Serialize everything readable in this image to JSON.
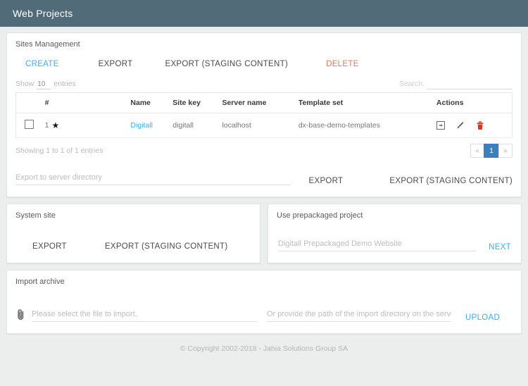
{
  "appbar": {
    "title": "Web Projects"
  },
  "sites_card": {
    "title": "Sites Management",
    "actions": {
      "create": "CREATE",
      "export": "EXPORT",
      "export_staging": "EXPORT (STAGING CONTENT)",
      "delete": "DELETE"
    },
    "datatable": {
      "length_prefix": "Show",
      "length_value": "10",
      "length_suffix": "entries",
      "search_label": "Search:",
      "search_value": "",
      "search_placeholder": "",
      "columns": [
        "",
        "#",
        "Name",
        "Site key",
        "Server name",
        "Template set",
        "Actions"
      ],
      "rows": [
        {
          "checked": false,
          "index": "1",
          "starred": "★",
          "name": "Digitall",
          "site_key": "digitall",
          "server_name": "localhost",
          "template_set": "dx-base-demo-templates",
          "actions": [
            "export-site-icon",
            "edit-icon",
            "delete-icon"
          ]
        }
      ],
      "info": "Showing 1 to 1 of 1 entries",
      "pagination": {
        "prev": "«",
        "pages": [
          "1"
        ],
        "next": "»",
        "active": "1"
      }
    },
    "export_dir": {
      "placeholder": "Export to server directory",
      "value": "",
      "export_label": "EXPORT",
      "export_staging_label": "EXPORT (STAGING CONTENT)"
    }
  },
  "system_site_card": {
    "title": "System site",
    "export_label": "EXPORT",
    "export_staging_label": "EXPORT (STAGING CONTENT)"
  },
  "prepackaged_card": {
    "title": "Use prepackaged project",
    "selected": "Digitall Prepackaged Demo Website",
    "next_label": "NEXT"
  },
  "import_card": {
    "title": "Import archive",
    "file_placeholder": "Please select the file to import.",
    "file_value": "",
    "path_placeholder": "Or provide the path of the import directory on the server.",
    "path_value": "",
    "upload_label": "UPLOAD"
  },
  "footer": {
    "text": "© Copyright 2002-2018 - Jahia Solutions Group SA"
  },
  "colors": {
    "appbar_bg": "#526b78",
    "accent_blue": "#37b0e9",
    "danger_red": "#f2705a",
    "pager_active": "#3c7fbe",
    "trash_red": "#f02b17"
  }
}
